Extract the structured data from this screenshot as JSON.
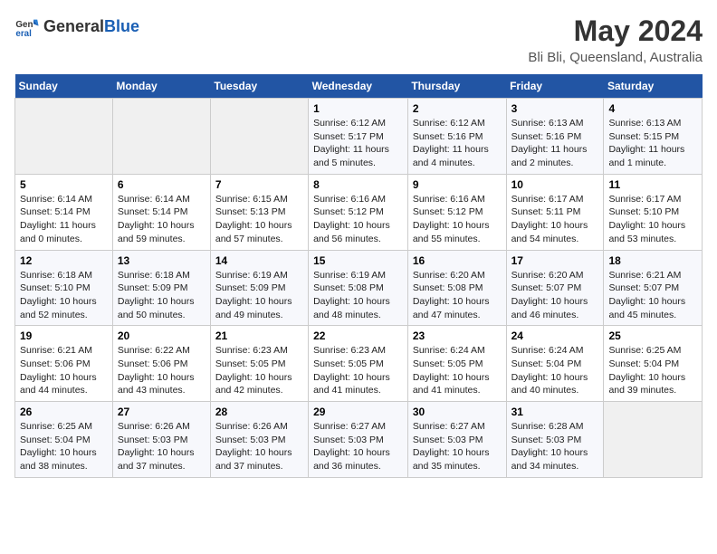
{
  "logo": {
    "general": "General",
    "blue": "Blue"
  },
  "calendar": {
    "title": "May 2024",
    "subtitle": "Bli Bli, Queensland, Australia"
  },
  "header_days": [
    "Sunday",
    "Monday",
    "Tuesday",
    "Wednesday",
    "Thursday",
    "Friday",
    "Saturday"
  ],
  "weeks": [
    {
      "days": [
        {
          "num": "",
          "info": ""
        },
        {
          "num": "",
          "info": ""
        },
        {
          "num": "",
          "info": ""
        },
        {
          "num": "1",
          "info": "Sunrise: 6:12 AM\nSunset: 5:17 PM\nDaylight: 11 hours\nand 5 minutes."
        },
        {
          "num": "2",
          "info": "Sunrise: 6:12 AM\nSunset: 5:16 PM\nDaylight: 11 hours\nand 4 minutes."
        },
        {
          "num": "3",
          "info": "Sunrise: 6:13 AM\nSunset: 5:16 PM\nDaylight: 11 hours\nand 2 minutes."
        },
        {
          "num": "4",
          "info": "Sunrise: 6:13 AM\nSunset: 5:15 PM\nDaylight: 11 hours\nand 1 minute."
        }
      ]
    },
    {
      "days": [
        {
          "num": "5",
          "info": "Sunrise: 6:14 AM\nSunset: 5:14 PM\nDaylight: 11 hours\nand 0 minutes."
        },
        {
          "num": "6",
          "info": "Sunrise: 6:14 AM\nSunset: 5:14 PM\nDaylight: 10 hours\nand 59 minutes."
        },
        {
          "num": "7",
          "info": "Sunrise: 6:15 AM\nSunset: 5:13 PM\nDaylight: 10 hours\nand 57 minutes."
        },
        {
          "num": "8",
          "info": "Sunrise: 6:16 AM\nSunset: 5:12 PM\nDaylight: 10 hours\nand 56 minutes."
        },
        {
          "num": "9",
          "info": "Sunrise: 6:16 AM\nSunset: 5:12 PM\nDaylight: 10 hours\nand 55 minutes."
        },
        {
          "num": "10",
          "info": "Sunrise: 6:17 AM\nSunset: 5:11 PM\nDaylight: 10 hours\nand 54 minutes."
        },
        {
          "num": "11",
          "info": "Sunrise: 6:17 AM\nSunset: 5:10 PM\nDaylight: 10 hours\nand 53 minutes."
        }
      ]
    },
    {
      "days": [
        {
          "num": "12",
          "info": "Sunrise: 6:18 AM\nSunset: 5:10 PM\nDaylight: 10 hours\nand 52 minutes."
        },
        {
          "num": "13",
          "info": "Sunrise: 6:18 AM\nSunset: 5:09 PM\nDaylight: 10 hours\nand 50 minutes."
        },
        {
          "num": "14",
          "info": "Sunrise: 6:19 AM\nSunset: 5:09 PM\nDaylight: 10 hours\nand 49 minutes."
        },
        {
          "num": "15",
          "info": "Sunrise: 6:19 AM\nSunset: 5:08 PM\nDaylight: 10 hours\nand 48 minutes."
        },
        {
          "num": "16",
          "info": "Sunrise: 6:20 AM\nSunset: 5:08 PM\nDaylight: 10 hours\nand 47 minutes."
        },
        {
          "num": "17",
          "info": "Sunrise: 6:20 AM\nSunset: 5:07 PM\nDaylight: 10 hours\nand 46 minutes."
        },
        {
          "num": "18",
          "info": "Sunrise: 6:21 AM\nSunset: 5:07 PM\nDaylight: 10 hours\nand 45 minutes."
        }
      ]
    },
    {
      "days": [
        {
          "num": "19",
          "info": "Sunrise: 6:21 AM\nSunset: 5:06 PM\nDaylight: 10 hours\nand 44 minutes."
        },
        {
          "num": "20",
          "info": "Sunrise: 6:22 AM\nSunset: 5:06 PM\nDaylight: 10 hours\nand 43 minutes."
        },
        {
          "num": "21",
          "info": "Sunrise: 6:23 AM\nSunset: 5:05 PM\nDaylight: 10 hours\nand 42 minutes."
        },
        {
          "num": "22",
          "info": "Sunrise: 6:23 AM\nSunset: 5:05 PM\nDaylight: 10 hours\nand 41 minutes."
        },
        {
          "num": "23",
          "info": "Sunrise: 6:24 AM\nSunset: 5:05 PM\nDaylight: 10 hours\nand 41 minutes."
        },
        {
          "num": "24",
          "info": "Sunrise: 6:24 AM\nSunset: 5:04 PM\nDaylight: 10 hours\nand 40 minutes."
        },
        {
          "num": "25",
          "info": "Sunrise: 6:25 AM\nSunset: 5:04 PM\nDaylight: 10 hours\nand 39 minutes."
        }
      ]
    },
    {
      "days": [
        {
          "num": "26",
          "info": "Sunrise: 6:25 AM\nSunset: 5:04 PM\nDaylight: 10 hours\nand 38 minutes."
        },
        {
          "num": "27",
          "info": "Sunrise: 6:26 AM\nSunset: 5:03 PM\nDaylight: 10 hours\nand 37 minutes."
        },
        {
          "num": "28",
          "info": "Sunrise: 6:26 AM\nSunset: 5:03 PM\nDaylight: 10 hours\nand 37 minutes."
        },
        {
          "num": "29",
          "info": "Sunrise: 6:27 AM\nSunset: 5:03 PM\nDaylight: 10 hours\nand 36 minutes."
        },
        {
          "num": "30",
          "info": "Sunrise: 6:27 AM\nSunset: 5:03 PM\nDaylight: 10 hours\nand 35 minutes."
        },
        {
          "num": "31",
          "info": "Sunrise: 6:28 AM\nSunset: 5:03 PM\nDaylight: 10 hours\nand 34 minutes."
        },
        {
          "num": "",
          "info": ""
        }
      ]
    }
  ]
}
